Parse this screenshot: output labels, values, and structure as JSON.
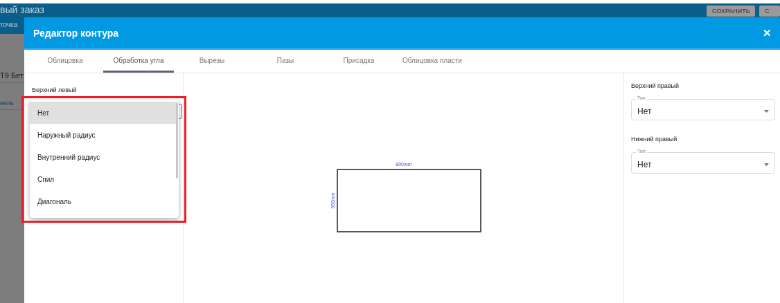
{
  "background_page": {
    "title": "вый заказ",
    "subtitle": "точка",
    "buttons": [
      "СОХРАНИТЬ",
      "С"
    ],
    "rows": [
      {
        "text": "Т9 Бет",
        "kind": "plain"
      },
      {
        "text": "нель",
        "kind": "link"
      }
    ]
  },
  "dialog": {
    "title": "Редактор контура",
    "close": "✕",
    "tabs": [
      {
        "label": "Облицовка",
        "selected": false
      },
      {
        "label": "Обработка угла",
        "selected": true
      },
      {
        "label": "Вырезы",
        "selected": false
      },
      {
        "label": "Пазы",
        "selected": false
      },
      {
        "label": "Присадка",
        "selected": false
      },
      {
        "label": "Облицовка пласти",
        "selected": false
      }
    ],
    "left_corners": [
      {
        "title": "Верхний левый"
      }
    ],
    "dropdown": [
      {
        "label": "Нет",
        "selected": true
      },
      {
        "label": "Наружный радиус",
        "selected": false
      },
      {
        "label": "Внутренний радиус",
        "selected": false
      },
      {
        "label": "Спил",
        "selected": false
      },
      {
        "label": "Диагональ",
        "selected": false
      }
    ],
    "drawing": {
      "width_label": "800mm",
      "height_label": "350mm"
    },
    "right_corners": [
      {
        "title": "Верхний правый",
        "field_label": "Тип",
        "value": "Нет"
      },
      {
        "title": "Нижний правый",
        "field_label": "Тип",
        "value": "Нет"
      }
    ]
  }
}
